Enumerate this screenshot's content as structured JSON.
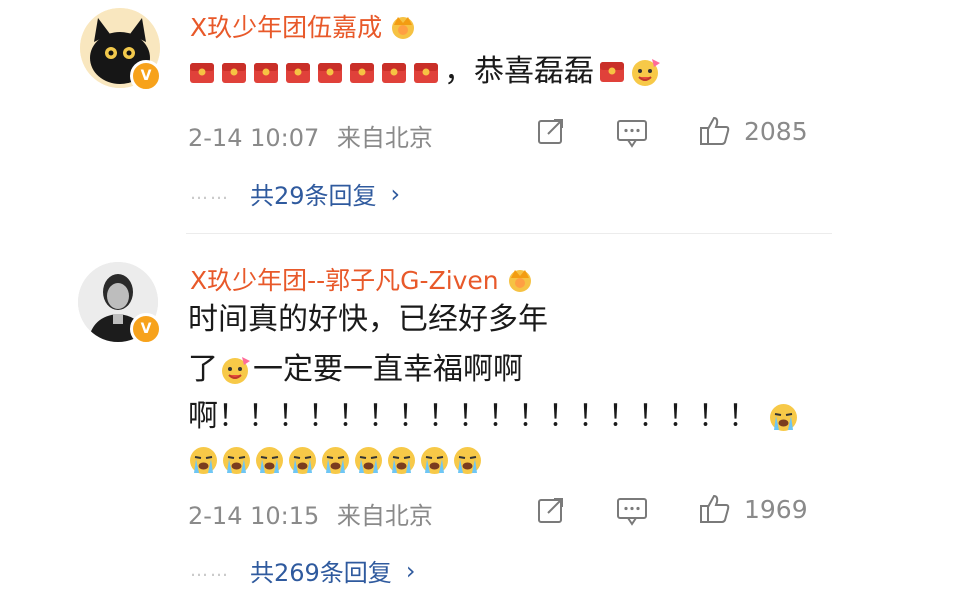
{
  "comments": [
    {
      "username": "X玖少年团伍嘉成",
      "avatar": "black-cat-avatar",
      "verified_badge": "V",
      "text_line1_suffix": "，恭喜磊磊",
      "red_envelope_count_before": 8,
      "timestamp": "2-14 10:07",
      "location": "来自北京",
      "likes": "2085",
      "replies_label": "共29条回复",
      "dots": "……"
    },
    {
      "username": "X玖少年团--郭子凡G-Ziven",
      "avatar": "portrait-avatar",
      "verified_badge": "V",
      "line1": "时间真的好快，已经好多年",
      "line2_prefix": "了",
      "line2_suffix": "一定要一直幸福啊啊",
      "line3": "啊！！！！！！！！！！！！！！！！！！",
      "crying_count_line3": 1,
      "crying_count_line4": 9,
      "timestamp": "2-14 10:15",
      "location": "来自北京",
      "likes": "1969",
      "replies_label": "共269条回复",
      "dots": "……"
    }
  ],
  "icons": {
    "share": "share-icon",
    "comment": "comment-icon",
    "like": "thumbs-up-icon",
    "crown": "crown-icon",
    "red_envelope": "red-envelope-icon",
    "celebrate_emoji": "celebrate-emoji-icon",
    "crying_emoji": "crying-emoji-icon"
  },
  "colors": {
    "username": "#e8592a",
    "reply_link": "#2f5a9e",
    "meta": "#8a8a8a",
    "badge": "#f7a21b"
  }
}
